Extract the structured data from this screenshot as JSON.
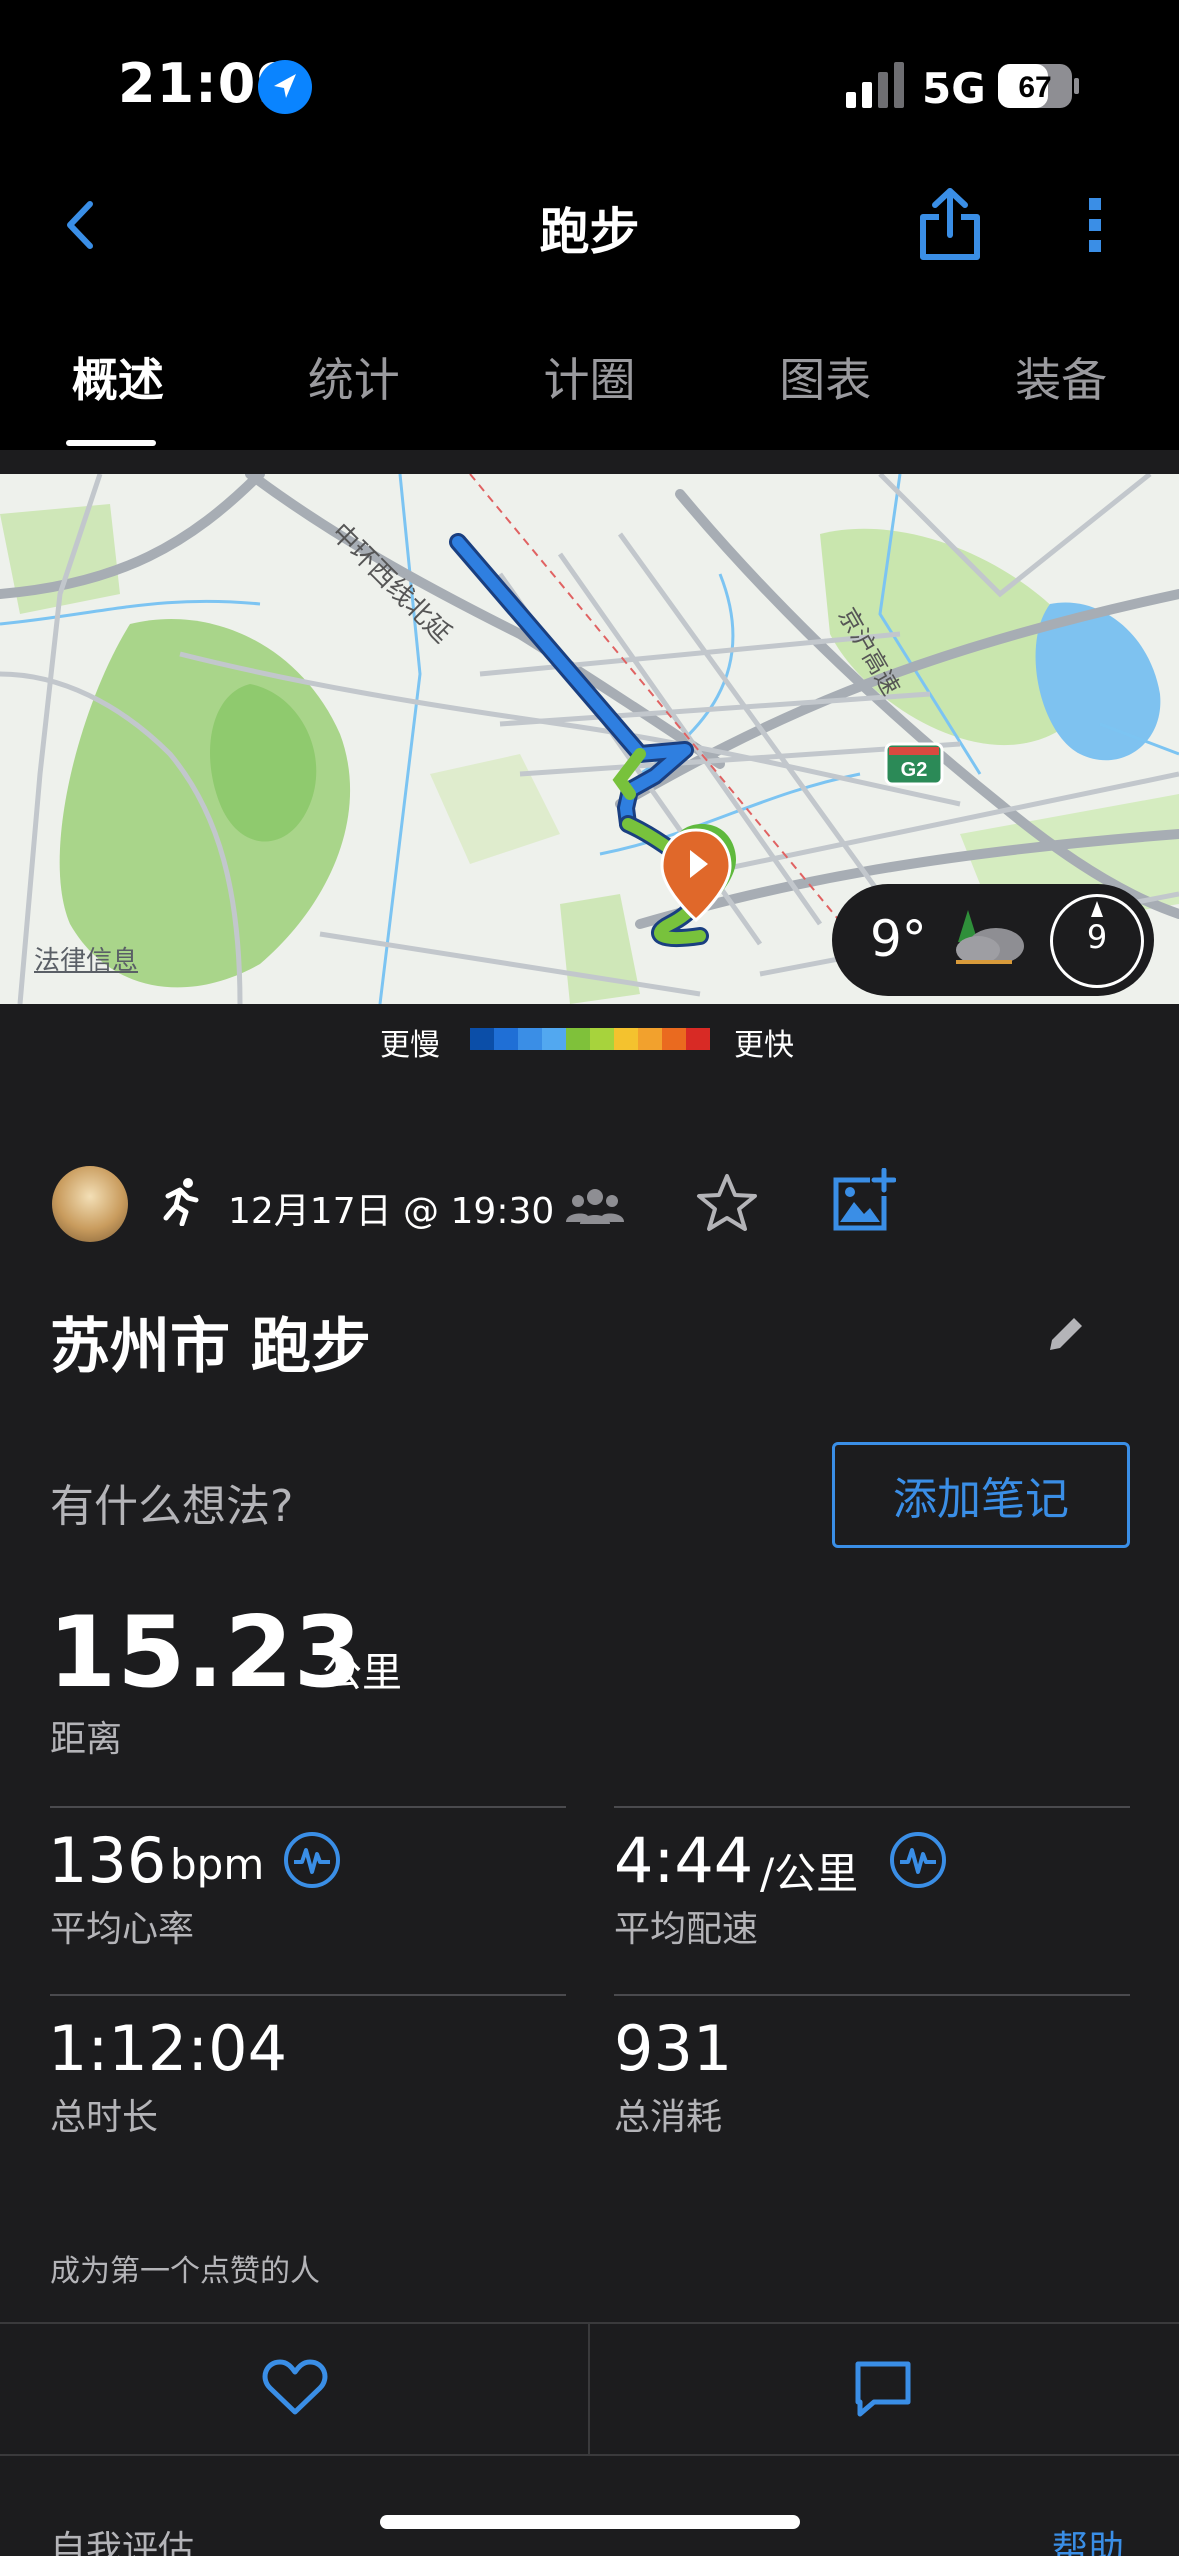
{
  "status_bar": {
    "time": "21:09",
    "network": "5G",
    "battery": "67"
  },
  "nav": {
    "title": "跑步"
  },
  "tabs": [
    {
      "label": "概述"
    },
    {
      "label": "统计"
    },
    {
      "label": "计圈"
    },
    {
      "label": "图表"
    },
    {
      "label": "装备"
    }
  ],
  "map": {
    "labels": {
      "road1": "中环西线北延",
      "road2": "京沪高速",
      "highway_shield": "G2"
    },
    "legal_link": "法律信息",
    "weather": {
      "temperature": "9°",
      "aqi": "9"
    }
  },
  "pace_legend": {
    "slow_label": "更慢",
    "fast_label": "更快",
    "colors": [
      "#0b4ea8",
      "#1f6fd6",
      "#3a8ee6",
      "#52a8f0",
      "#7fc13a",
      "#a7d33c",
      "#f4c22e",
      "#f2a12d",
      "#ea6a1f",
      "#d82a25"
    ]
  },
  "activity": {
    "date": "12月17日 @ 19:30",
    "title": "苏州市 跑步",
    "thoughts_placeholder": "有什么想法?",
    "add_note_label": "添加笔记"
  },
  "stats": {
    "distance": {
      "value": "15.23",
      "unit": "公里",
      "label": "距离"
    },
    "avg_hr": {
      "value": "136",
      "unit": "bpm",
      "label": "平均心率"
    },
    "avg_pace": {
      "value": "4:44",
      "unit": "/公里",
      "label": "平均配速"
    },
    "duration": {
      "value": "1:12:04",
      "label": "总时长"
    },
    "calories": {
      "value": "931",
      "label": "总消耗"
    }
  },
  "social": {
    "likes_text": "成为第一个点赞的人"
  },
  "footer": {
    "self_eval_label": "自我评估",
    "help_label": "帮助"
  },
  "colors": {
    "accent": "#3a8ee6",
    "background": "#1c1c1e",
    "route_blue": "#2f7fe0",
    "route_green": "#78c23c"
  }
}
